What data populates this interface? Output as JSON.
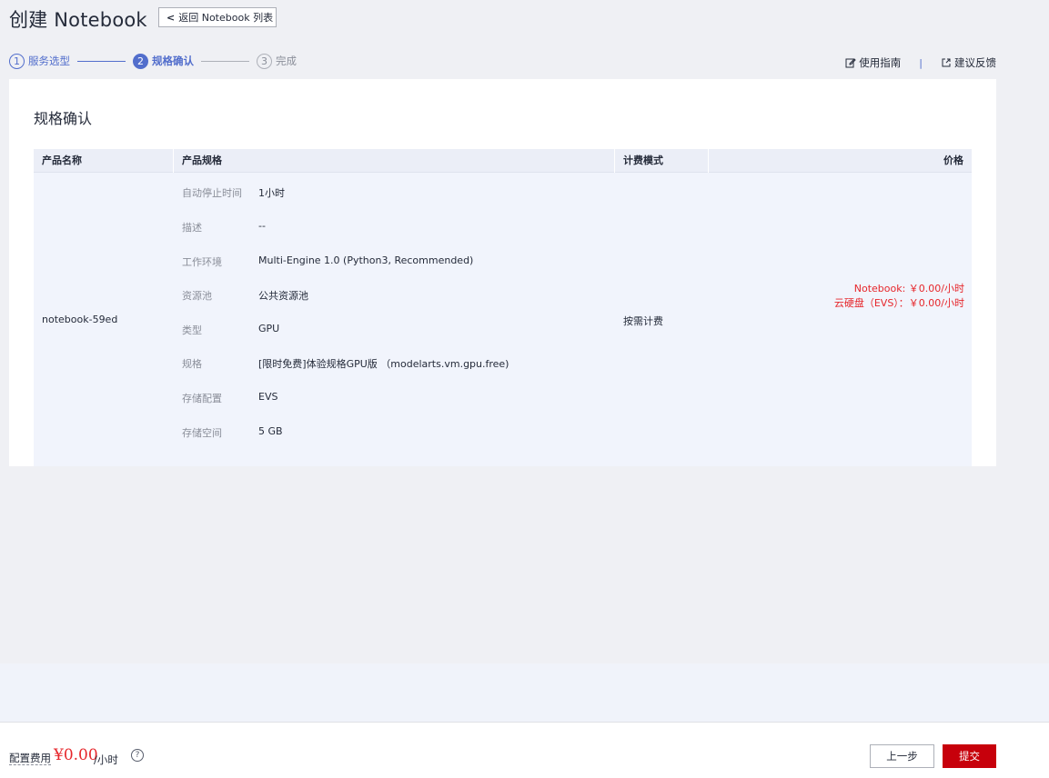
{
  "header": {
    "title": "创建 Notebook",
    "back_label": "返回 Notebook 列表"
  },
  "steps": [
    {
      "num": "1",
      "label": "服务选型",
      "state": "done"
    },
    {
      "num": "2",
      "label": "规格确认",
      "state": "active"
    },
    {
      "num": "3",
      "label": "完成",
      "state": "todo"
    }
  ],
  "links": {
    "guide": "使用指南",
    "separator": "|",
    "feedback": "建议反馈"
  },
  "card": {
    "title": "规格确认",
    "columns": [
      "产品名称",
      "产品规格",
      "计费模式",
      "价格"
    ],
    "product_name": "notebook-59ed",
    "specs": [
      {
        "key": "自动停止时间",
        "value": "1小时"
      },
      {
        "key": "描述",
        "value": "--"
      },
      {
        "key": "工作环境",
        "value": "Multi-Engine 1.0 (Python3, Recommended)"
      },
      {
        "key": "资源池",
        "value": "公共资源池"
      },
      {
        "key": "类型",
        "value": "GPU"
      },
      {
        "key": "规格",
        "value": "[限时免费]体验规格GPU版 （modelarts.vm.gpu.free)"
      },
      {
        "key": "存储配置",
        "value": "EVS"
      },
      {
        "key": "存储空间",
        "value": "5 GB"
      }
    ],
    "billing_mode": "按需计费",
    "price_lines": [
      "Notebook: ￥0.00/小时",
      "云硬盘（EVS）：￥0.00/小时"
    ]
  },
  "footer": {
    "fee_label": "配置费用",
    "fee_amount": "¥0.00",
    "fee_unit": "/小时",
    "help_icon": "?",
    "prev_label": "上一步",
    "submit_label": "提交"
  },
  "colors": {
    "accent": "#526ecc",
    "price": "#e6262b",
    "submit": "#c7000b"
  }
}
